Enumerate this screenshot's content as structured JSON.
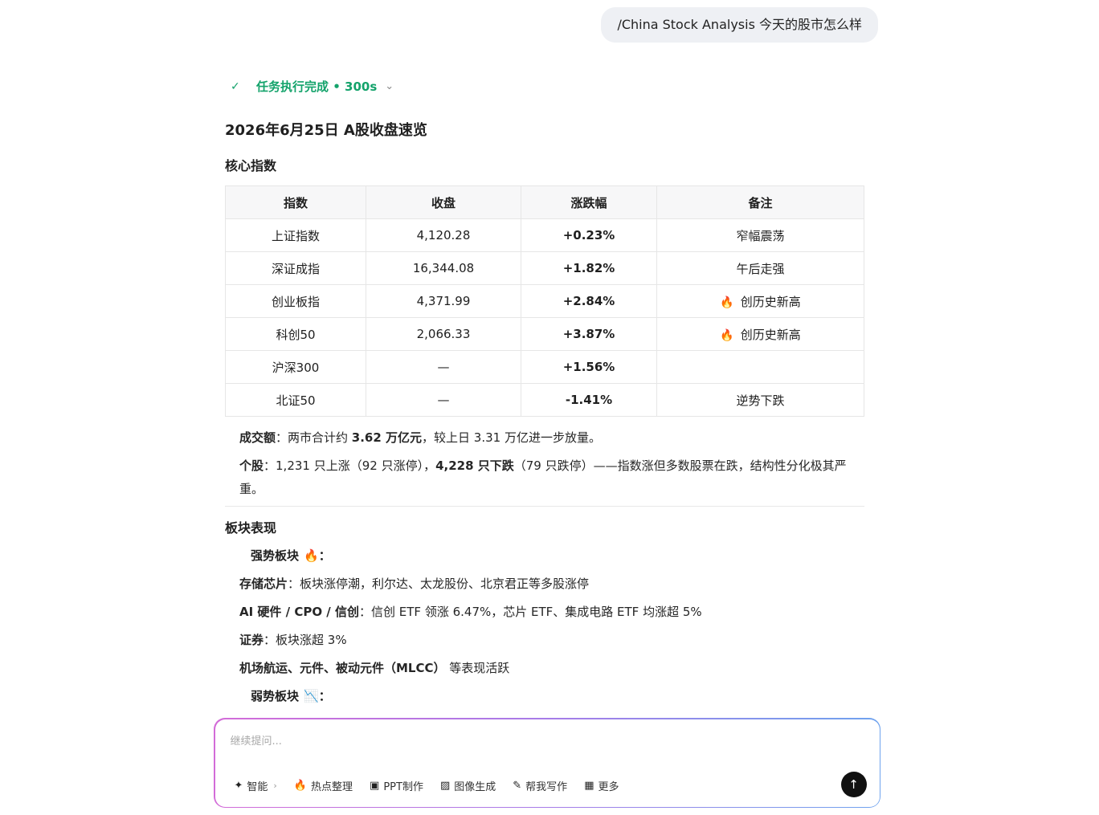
{
  "user_message": "/China Stock Analysis 今天的股市怎么样",
  "status": {
    "label": "任务执行完成 • 300s",
    "check_icon": "✓",
    "chevron_icon": "⌄",
    "color": "#14a36b"
  },
  "title": "2026年6月25日 A股收盘速览",
  "core_heading": "核心指数",
  "table": {
    "headers": [
      "指数",
      "收盘",
      "涨跌幅",
      "备注"
    ],
    "rows": [
      {
        "name": "上证指数",
        "close": "4,120.28",
        "change": "+0.23%",
        "note": "窄幅震荡",
        "fire": false
      },
      {
        "name": "深证成指",
        "close": "16,344.08",
        "change": "+1.82%",
        "note": "午后走强",
        "fire": false
      },
      {
        "name": "创业板指",
        "close": "4,371.99",
        "change": "+2.84%",
        "note": "创历史新高",
        "fire": true
      },
      {
        "name": "科创50",
        "close": "2,066.33",
        "change": "+3.87%",
        "note": "创历史新高",
        "fire": true
      },
      {
        "name": "沪深300",
        "close": "—",
        "change": "+1.56%",
        "note": "",
        "fire": false
      },
      {
        "name": "北证50",
        "close": "—",
        "change": "-1.41%",
        "note": "逆势下跌",
        "fire": false
      }
    ]
  },
  "turnover": {
    "label": "成交额",
    "pre": "：两市合计约 ",
    "bold": "3.62 万亿元",
    "post": "，较上日 3.31 万亿进一步放量。"
  },
  "stocks": {
    "label": "个股",
    "pre": "：1,231 只上涨（92 只涨停），",
    "bold": "4,228 只下跌",
    "post": "（79 只跌停）——指数涨但多数股票在跌，结构性分化极其严重。"
  },
  "sector_heading": "板块表现",
  "strong": {
    "label": "强势板块",
    "emoji": "🔥",
    "suffix": "："
  },
  "sectors": [
    {
      "name": "存储芯片",
      "desc": "：板块涨停潮，利尔达、太龙股份、北京君正等多股涨停"
    },
    {
      "name": "AI 硬件 / CPO / 信创",
      "desc": "：信创 ETF 领涨 6.47%，芯片 ETF、集成电路 ETF 均涨超 5%"
    },
    {
      "name": "证券",
      "desc": "：板块涨超 3%"
    },
    {
      "name": "机场航运、元件、被动元件（MLCC）",
      "desc": " 等表现活跃"
    }
  ],
  "weak": {
    "label": "弱势板块",
    "emoji": "📉",
    "suffix": "："
  },
  "composer": {
    "placeholder": "继续提问...",
    "tools": [
      {
        "icon": "✦",
        "label": "智能",
        "arrow": "›"
      },
      {
        "icon": "🔥",
        "label": "热点整理"
      },
      {
        "icon": "▣",
        "label": "PPT制作"
      },
      {
        "icon": "▨",
        "label": "图像生成"
      },
      {
        "icon": "✎",
        "label": "帮我写作"
      },
      {
        "icon": "▦",
        "label": "更多"
      }
    ],
    "send_icon": "↑"
  }
}
